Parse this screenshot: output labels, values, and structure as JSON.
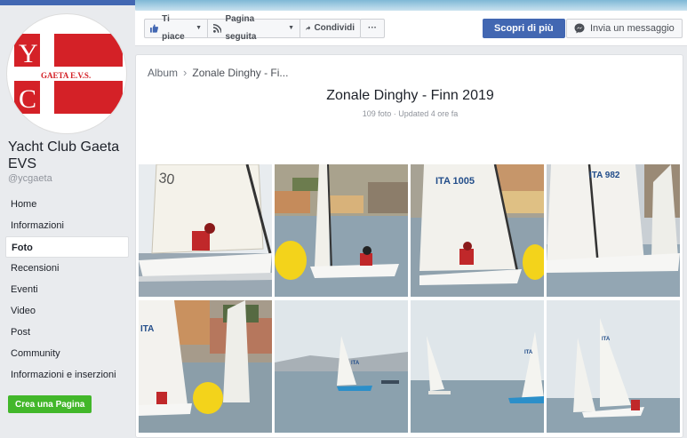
{
  "sidebar": {
    "logo_letters": [
      "Y",
      "C"
    ],
    "logo_text": "GAETA E.V.S.",
    "page_name": "Yacht Club Gaeta EVS",
    "handle": "@ycgaeta",
    "items": [
      {
        "label": "Home",
        "active": false
      },
      {
        "label": "Informazioni",
        "active": false
      },
      {
        "label": "Foto",
        "active": true
      },
      {
        "label": "Recensioni",
        "active": false
      },
      {
        "label": "Eventi",
        "active": false
      },
      {
        "label": "Video",
        "active": false
      },
      {
        "label": "Post",
        "active": false
      },
      {
        "label": "Community",
        "active": false
      },
      {
        "label": "Informazioni e inserzioni",
        "active": false
      }
    ],
    "create_page_label": "Crea una Pagina"
  },
  "actionbar": {
    "like_label": "Ti piace",
    "follow_label": "Pagina seguita",
    "share_label": "Condividi",
    "more_label": "···",
    "learn_more_label": "Scopri di più",
    "message_label": "Invia un messaggio"
  },
  "album": {
    "breadcrumb_root": "Album",
    "breadcrumb_current": "Zonale Dinghy - Fi...",
    "title": "Zonale Dinghy - Finn 2019",
    "meta": "109 foto · Updated 4 ore fa",
    "photos": [
      {
        "sail_number": "30"
      },
      {
        "sail_number": ""
      },
      {
        "sail_number": "ITA 1005"
      },
      {
        "sail_number": "ITA 982"
      },
      {
        "sail_number": "ITA"
      },
      {
        "sail_number": "ITA"
      },
      {
        "sail_number": "ITA"
      },
      {
        "sail_number": "ITA"
      }
    ]
  },
  "colors": {
    "facebook_blue": "#4267b2",
    "green": "#42b72a",
    "logo_red": "#d42127"
  }
}
